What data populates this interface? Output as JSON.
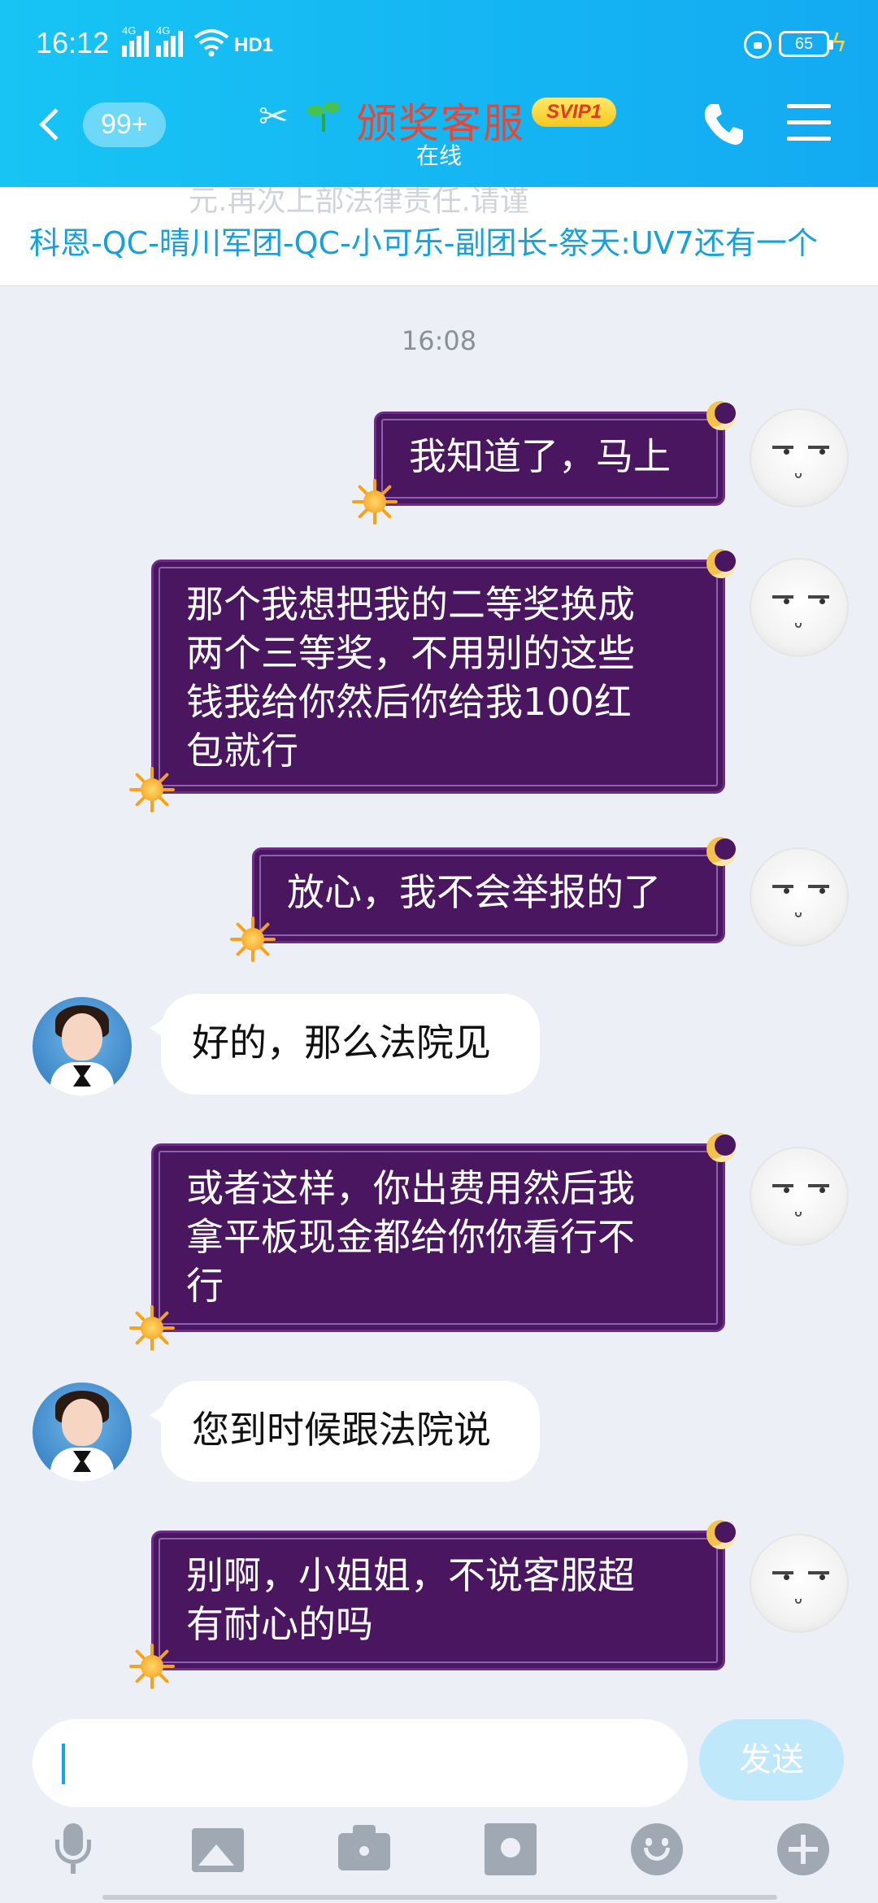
{
  "status_bar": {
    "time": "16:12",
    "sim1_label": "4G",
    "sim2_label": "4G",
    "hd_label": "HD1",
    "battery_level": "65",
    "battery_charging": true
  },
  "header": {
    "unread_count": "99+",
    "contact_name": "颁奖客服",
    "vip_badge": "SVIP1",
    "presence": "在线"
  },
  "pinned": {
    "ghost_text": "元.再次上部法律责任.请谨",
    "text": "科恩-QC-晴川军团-QC-小可乐-副团长-祭天:UV7还有一个"
  },
  "chat": {
    "timestamp": "16:08",
    "messages": [
      {
        "side": "out",
        "text": "我知道了，马上"
      },
      {
        "side": "out",
        "text": "那个我想把我的二等奖换成\n两个三等奖，不用别的这些\n钱我给你然后你给我100红\n包就行"
      },
      {
        "side": "out",
        "text": "放心，我不会举报的了"
      },
      {
        "side": "in",
        "text": "好的，那么法院见"
      },
      {
        "side": "out",
        "text": "或者这样，你出费用然后我\n拿平板现金都给你你看行不\n行"
      },
      {
        "side": "in",
        "text": "您到时候跟法院说"
      },
      {
        "side": "out",
        "text": "别啊，小姐姐，不说客服超\n有耐心的吗"
      }
    ]
  },
  "input": {
    "value": "",
    "send_label": "发送"
  },
  "toolbar": {
    "icons": [
      "mic-icon",
      "image-icon",
      "camera-icon",
      "red-packet-icon",
      "emoji-icon",
      "plus-icon"
    ]
  },
  "colors": {
    "header_start": "#17c4f4",
    "header_end": "#13aaf2",
    "outgoing_bubble": "#4a1660",
    "pinned_text": "#17a1dc",
    "contact_name": "#e04a3a"
  }
}
